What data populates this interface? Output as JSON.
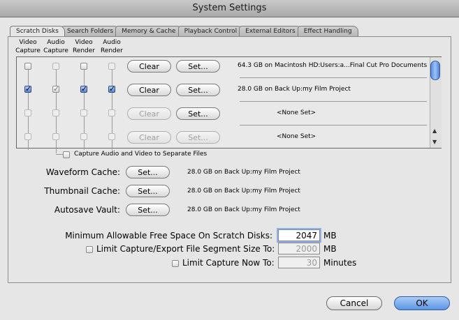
{
  "window": {
    "title": "System Settings"
  },
  "tabs": [
    "Scratch Disks",
    "Search Folders",
    "Memory & Cache",
    "Playback Control",
    "External Editors",
    "Effect Handling"
  ],
  "columns": [
    "Video\nCapture",
    "Audio\nCapture",
    "Video\nRender",
    "Audio\nRender"
  ],
  "scratch_disks": {
    "clear_label": "Clear",
    "set_label": "Set...",
    "rows": [
      {
        "path": "64.3 GB on  Macintosh HD:Users:a...Final Cut Pro Documents",
        "checks": [
          false,
          false,
          false,
          false
        ],
        "enabled": true
      },
      {
        "path": "28.0 GB on  Back Up:my Film Project",
        "checks": [
          true,
          true,
          true,
          true
        ],
        "enabled": true
      },
      {
        "path": "<None Set>",
        "checks": [
          false,
          false,
          false,
          false
        ],
        "enabled": false
      },
      {
        "path": "<None Set>",
        "checks": [
          false,
          false,
          false,
          false
        ],
        "enabled": false
      }
    ],
    "separate_files_label": "Capture Audio and Video to Separate Files"
  },
  "caches": [
    {
      "label": "Waveform Cache:",
      "button": "Set...",
      "path": "28.0 GB on  Back Up:my Film Project"
    },
    {
      "label": "Thumbnail Cache:",
      "button": "Set...",
      "path": "28.0 GB on  Back Up:my Film Project"
    },
    {
      "label": "Autosave Vault:",
      "button": "Set...",
      "path": "28.0 GB on  Back Up:my Film Project"
    }
  ],
  "limits": {
    "min_free_label": "Minimum Allowable Free Space On Scratch Disks:",
    "min_free_value": "2047",
    "min_free_unit": "MB",
    "segment_label": "Limit Capture/Export File Segment Size To:",
    "segment_value": "2000",
    "segment_unit": "MB",
    "capture_now_label": "Limit Capture Now To:",
    "capture_now_value": "30",
    "capture_now_unit": "Minutes"
  },
  "dialog": {
    "cancel": "Cancel",
    "ok": "OK"
  }
}
